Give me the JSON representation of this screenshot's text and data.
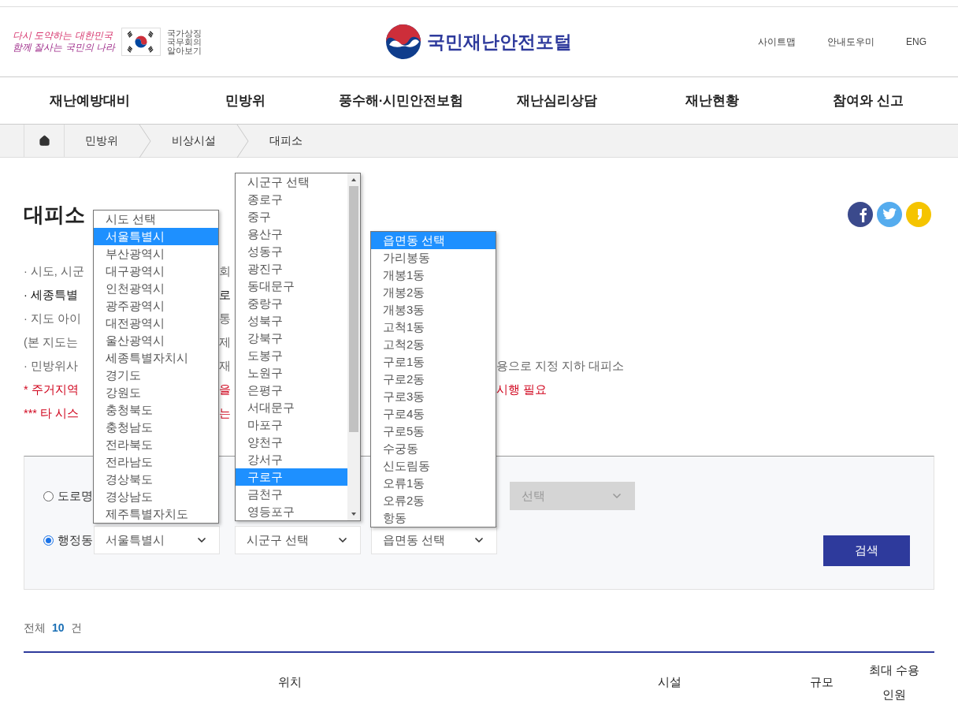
{
  "header": {
    "slogan": [
      "다시 도약하는 대한민국",
      "함께 잘사는 국민의 나라"
    ],
    "symbol_link": [
      "국가상징",
      "국무회의",
      "알아보기"
    ],
    "logo_text": "국민재난안전포털",
    "utility_links": [
      "사이트맵",
      "안내도우미",
      "ENG"
    ]
  },
  "nav": [
    "재난예방대비",
    "민방위",
    "풍수해·시민안전보험",
    "재난심리상담",
    "재난현황",
    "참여와 신고"
  ],
  "breadcrumb": [
    "민방위",
    "비상시설",
    "대피소"
  ],
  "page_title": "대피소",
  "social": [
    {
      "kind": "facebook",
      "color": "#3b4a8c"
    },
    {
      "kind": "twitter",
      "color": "#55acee"
    },
    {
      "kind": "kakao",
      "color": "#f5c400"
    }
  ],
  "notes": [
    {
      "kind": "normal",
      "left": "· 시도, 시군",
      "middle": "회"
    },
    {
      "kind": "emphasis",
      "left": "· 세종특별",
      "middle": "로"
    },
    {
      "kind": "normal",
      "left": "· 지도 아이",
      "middle": "통"
    },
    {
      "kind": "normal",
      "left": "(본 지도는",
      "middle": "제"
    },
    {
      "kind": "normal",
      "left": "· 민방위사",
      "middle": "재",
      "right": "용으로 지정 지하 대피소"
    },
    {
      "kind": "warning",
      "left": "* 주거지역",
      "middle": "을",
      "right": "시행 필요"
    },
    {
      "kind": "warning",
      "left": "*** 타 시스",
      "middle": "는"
    }
  ],
  "search": {
    "rows": [
      {
        "label": "도로명",
        "selected": false,
        "fields": [
          {
            "value": "선택",
            "disabled": true
          }
        ]
      },
      {
        "label": "행정동",
        "selected": true,
        "fields": [
          {
            "value": "서울특별시",
            "disabled": false
          },
          {
            "value": "시군구 선택",
            "disabled": false
          },
          {
            "value": "읍면동 선택",
            "disabled": false
          }
        ]
      }
    ],
    "button": "검색"
  },
  "dropdowns": [
    {
      "kind": "plain",
      "options": [
        {
          "label": "시도 선택",
          "selected": false
        },
        {
          "label": "서울특별시",
          "selected": true
        },
        {
          "label": "부산광역시",
          "selected": false
        },
        {
          "label": "대구광역시",
          "selected": false
        },
        {
          "label": "인천광역시",
          "selected": false
        },
        {
          "label": "광주광역시",
          "selected": false
        },
        {
          "label": "대전광역시",
          "selected": false
        },
        {
          "label": "울산광역시",
          "selected": false
        },
        {
          "label": "세종특별자치시",
          "selected": false
        },
        {
          "label": "경기도",
          "selected": false
        },
        {
          "label": "강원도",
          "selected": false
        },
        {
          "label": "충청북도",
          "selected": false
        },
        {
          "label": "충청남도",
          "selected": false
        },
        {
          "label": "전라북도",
          "selected": false
        },
        {
          "label": "전라남도",
          "selected": false
        },
        {
          "label": "경상북도",
          "selected": false
        },
        {
          "label": "경상남도",
          "selected": false
        },
        {
          "label": "제주특별자치도",
          "selected": false
        }
      ]
    },
    {
      "kind": "scrolling",
      "options": [
        {
          "label": "시군구 선택",
          "selected": false
        },
        {
          "label": "종로구",
          "selected": false
        },
        {
          "label": "중구",
          "selected": false
        },
        {
          "label": "용산구",
          "selected": false
        },
        {
          "label": "성동구",
          "selected": false
        },
        {
          "label": "광진구",
          "selected": false
        },
        {
          "label": "동대문구",
          "selected": false
        },
        {
          "label": "중랑구",
          "selected": false
        },
        {
          "label": "성북구",
          "selected": false
        },
        {
          "label": "강북구",
          "selected": false
        },
        {
          "label": "도봉구",
          "selected": false
        },
        {
          "label": "노원구",
          "selected": false
        },
        {
          "label": "은평구",
          "selected": false
        },
        {
          "label": "서대문구",
          "selected": false
        },
        {
          "label": "마포구",
          "selected": false
        },
        {
          "label": "양천구",
          "selected": false
        },
        {
          "label": "강서구",
          "selected": false
        },
        {
          "label": "구로구",
          "selected": true
        },
        {
          "label": "금천구",
          "selected": false
        },
        {
          "label": "영등포구",
          "selected": false
        }
      ]
    },
    {
      "kind": "plain",
      "options": [
        {
          "label": "읍면동 선택",
          "selected": true
        },
        {
          "label": "가리봉동",
          "selected": false
        },
        {
          "label": "개봉1동",
          "selected": false
        },
        {
          "label": "개봉2동",
          "selected": false
        },
        {
          "label": "개봉3동",
          "selected": false
        },
        {
          "label": "고척1동",
          "selected": false
        },
        {
          "label": "고척2동",
          "selected": false
        },
        {
          "label": "구로1동",
          "selected": false
        },
        {
          "label": "구로2동",
          "selected": false
        },
        {
          "label": "구로3동",
          "selected": false
        },
        {
          "label": "구로4동",
          "selected": false
        },
        {
          "label": "구로5동",
          "selected": false
        },
        {
          "label": "수궁동",
          "selected": false
        },
        {
          "label": "신도림동",
          "selected": false
        },
        {
          "label": "오류1동",
          "selected": false
        },
        {
          "label": "오류2동",
          "selected": false
        },
        {
          "label": "항동",
          "selected": false
        }
      ]
    }
  ],
  "results": {
    "label": "전체",
    "count": "10",
    "unit": "건"
  },
  "table": {
    "columns": [
      "위치",
      "시설",
      "규모",
      "최대 수용인원"
    ]
  }
}
